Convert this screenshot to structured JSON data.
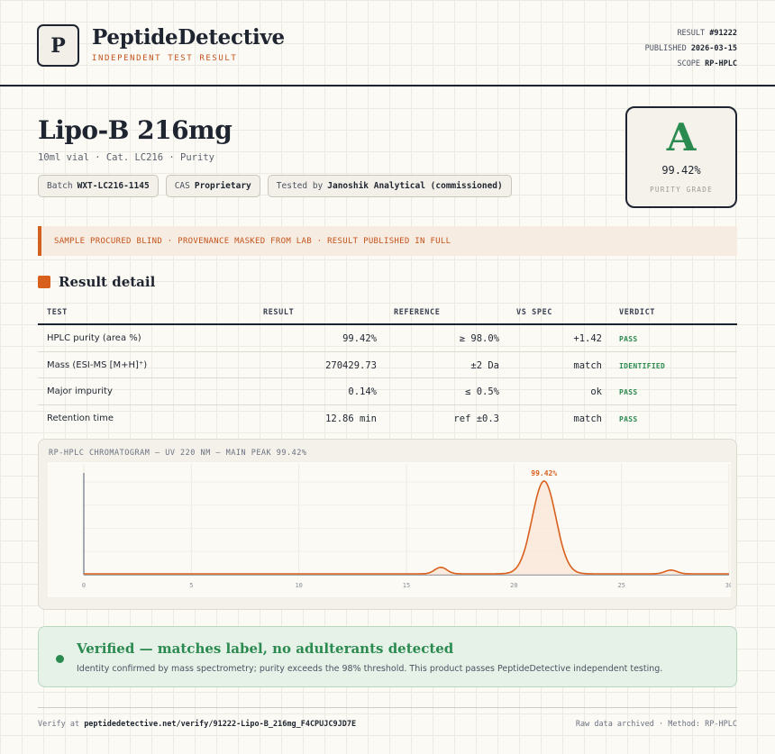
{
  "header": {
    "logo_letter": "P",
    "brand": "PeptideDetective",
    "brand_sub": "INDEPENDENT TEST RESULT",
    "meta": [
      {
        "label": "RESULT",
        "value": "#91222"
      },
      {
        "label": "PUBLISHED",
        "value": "2026-03-15"
      },
      {
        "label": "SCOPE",
        "value": "RP-HPLC"
      }
    ]
  },
  "product": {
    "title": "Lipo-B 216mg",
    "subtitle": "10ml vial · Cat. LC216 · Purity",
    "chips": [
      {
        "label": "Batch",
        "value": "WXT-LC216-1145"
      },
      {
        "label": "CAS",
        "value": "Proprietary"
      },
      {
        "label": "Tested by",
        "value": "Janoshik Analytical (commissioned)"
      }
    ]
  },
  "grade": {
    "letter": "A",
    "value": "99.42%",
    "label": "PURITY GRADE",
    "color": "#2b8a4f"
  },
  "banner": "SAMPLE PROCURED BLIND · PROVENANCE MASKED FROM LAB · RESULT PUBLISHED IN FULL",
  "section_title": "Result detail",
  "table": {
    "headers": [
      "TEST",
      "RESULT",
      "REFERENCE",
      "VS SPEC",
      "VERDICT"
    ],
    "rows": [
      {
        "test": "HPLC purity (area %)",
        "result": "99.42%",
        "reference": "≥ 98.0%",
        "spec": "+1.42",
        "verdict": "PASS"
      },
      {
        "test": "Mass (ESI-MS [M+H]⁺)",
        "result": "270429.73",
        "reference": "±2 Da",
        "spec": "match",
        "verdict": "IDENTIFIED"
      },
      {
        "test": "Major impurity",
        "result": "0.14%",
        "reference": "≤ 0.5%",
        "spec": "ok",
        "verdict": "PASS"
      },
      {
        "test": "Retention time",
        "result": "12.86 min",
        "reference": "ref ±0.3",
        "spec": "match",
        "verdict": "PASS"
      }
    ]
  },
  "chromatogram": {
    "title": "RP-HPLC CHROMATOGRAM — UV 220 NM — MAIN PEAK 99.42%",
    "peak_label": "99.42%",
    "line_color": "#d9601c"
  },
  "chart_data": {
    "type": "line",
    "title": "RP-HPLC CHROMATOGRAM — UV 220 NM — MAIN PEAK 99.42%",
    "xlabel": "",
    "ylabel": "",
    "xlim": [
      0,
      30
    ],
    "x_ticks": [
      "0",
      "5",
      "10",
      "15",
      "20",
      "25",
      "30"
    ],
    "baseline": 0.01,
    "peaks": [
      {
        "center": 16.6,
        "width": 0.28,
        "height": 0.07
      },
      {
        "center": 21.4,
        "width": 0.55,
        "height": 1.0,
        "label": "99.42%"
      },
      {
        "center": 27.3,
        "width": 0.28,
        "height": 0.04
      }
    ],
    "grid": true
  },
  "verified": {
    "title": "Verified — matches label, no adulterants detected",
    "text": "Identity confirmed by mass spectrometry; purity exceeds the 98% threshold. This product passes PeptideDetective independent testing."
  },
  "footer": {
    "verify_prefix": "Verify at",
    "verify_url": "peptidedetective.net/verify/91222-Lipo-B_216mg_F4CPUJC9JD7E",
    "right": "Raw data archived · Method: RP-HPLC"
  }
}
